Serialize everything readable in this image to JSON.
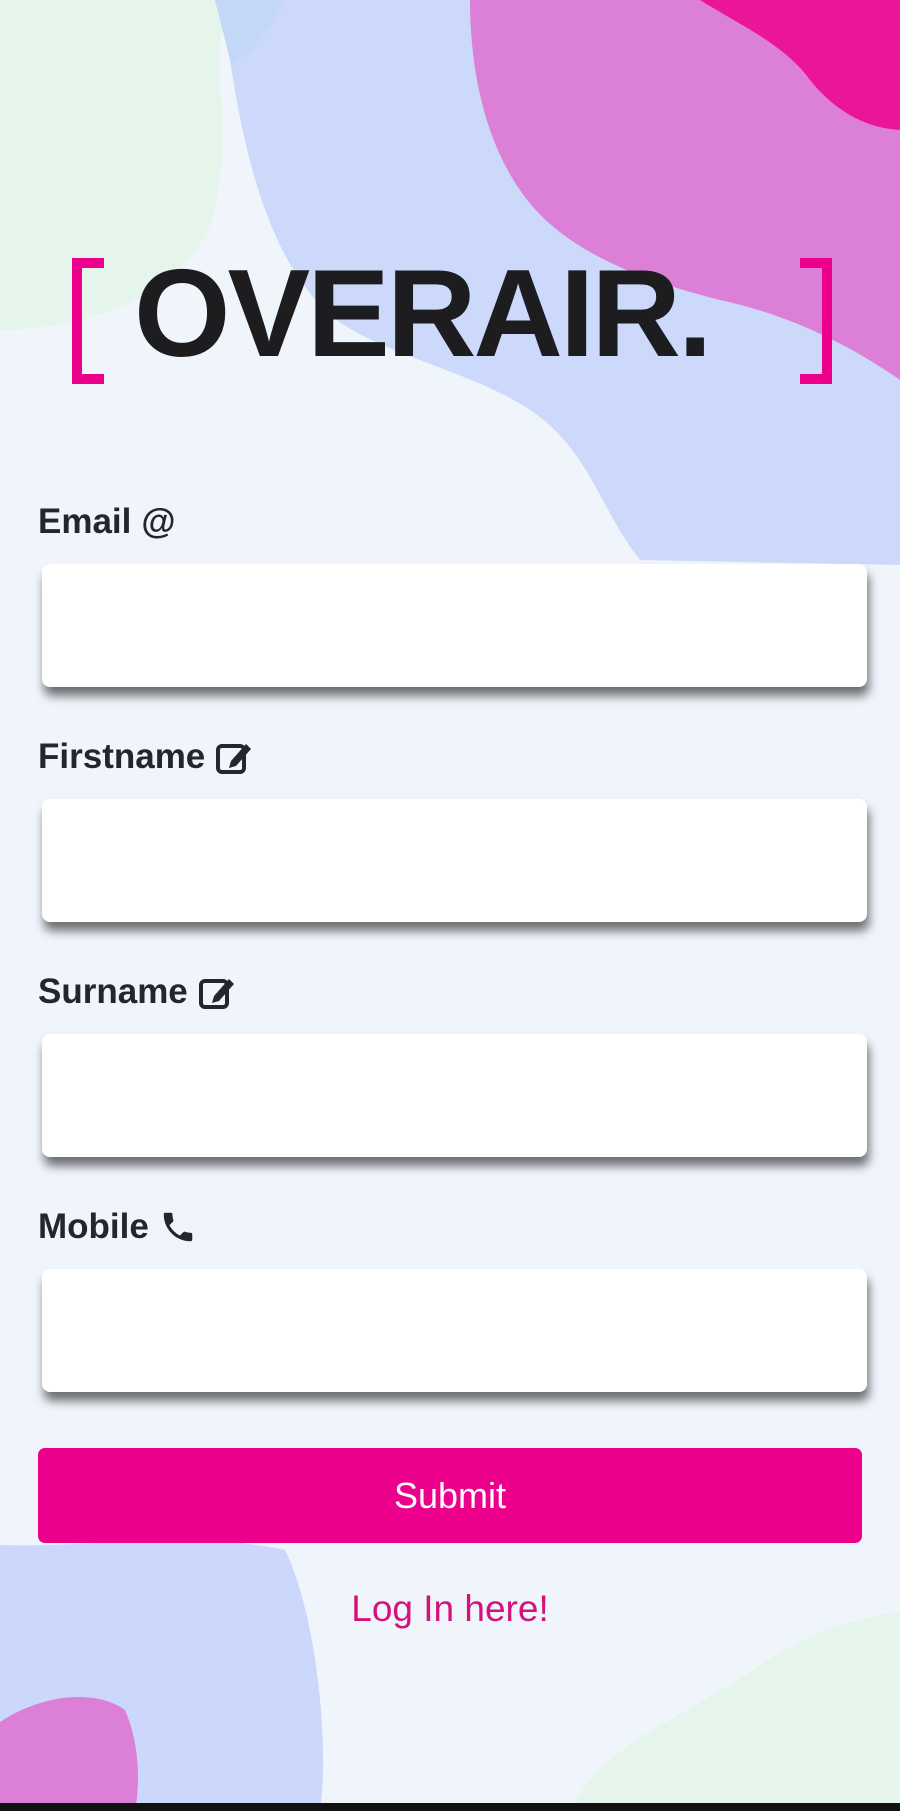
{
  "colors": {
    "accent": "#ec008c",
    "link": "#d6127a",
    "text": "#25252b",
    "background": "#f0f5fc"
  },
  "logo": {
    "text": "OVERAIR."
  },
  "form": {
    "fields": [
      {
        "label": "Email",
        "icon": "at-sign-icon",
        "icon_glyph": "@",
        "value": "",
        "placeholder": ""
      },
      {
        "label": "Firstname",
        "icon": "edit-icon",
        "value": "",
        "placeholder": ""
      },
      {
        "label": "Surname",
        "icon": "edit-icon",
        "value": "",
        "placeholder": ""
      },
      {
        "label": "Mobile",
        "icon": "phone-icon",
        "value": "",
        "placeholder": ""
      }
    ],
    "submit_label": "Submit",
    "login_link": "Log In here!"
  }
}
